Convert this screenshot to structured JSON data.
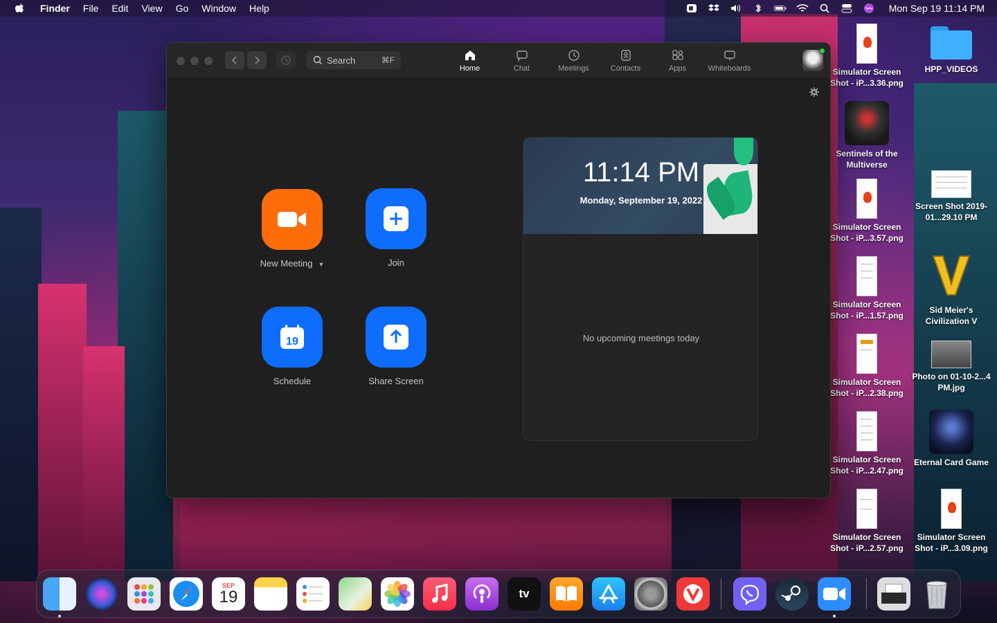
{
  "menubar": {
    "app_name": "Finder",
    "items": [
      "File",
      "Edit",
      "View",
      "Go",
      "Window",
      "Help"
    ],
    "clock": "Mon Sep 19  11:14 PM"
  },
  "desktop": {
    "items": [
      {
        "label": "Simulator Screen Shot - iP...3.36.png"
      },
      {
        "label": "HPP_VIDEOS"
      },
      {
        "label": "Sentinels of the Multiverse"
      },
      {
        "label": "Screen Shot 2019-01...29.10 PM"
      },
      {
        "label": "Simulator Screen Shot - iP...3.57.png"
      },
      {
        "label": "Sid Meier's Civilization V"
      },
      {
        "label": "Simulator Screen Shot - iP...1.57.png"
      },
      {
        "label": "Photo on 01-10-2...4 PM.jpg"
      },
      {
        "label": "Simulator Screen Shot - iP...2.38.png"
      },
      {
        "label": "Eternal Card Game"
      },
      {
        "label": "Simulator Screen Shot - iP...2.47.png"
      },
      {
        "label": "Simulator Screen Shot - iP...3.09.png"
      },
      {
        "label": "Simulator Screen Shot - iP...2.57.png"
      }
    ]
  },
  "zoom": {
    "search": {
      "placeholder": "Search",
      "shortcut": "⌘F"
    },
    "tabs": [
      {
        "label": "Home",
        "icon": "home-icon"
      },
      {
        "label": "Chat",
        "icon": "chat-icon"
      },
      {
        "label": "Meetings",
        "icon": "clock-icon"
      },
      {
        "label": "Contacts",
        "icon": "contacts-icon"
      },
      {
        "label": "Apps",
        "icon": "apps-icon"
      },
      {
        "label": "Whiteboards",
        "icon": "whiteboard-icon"
      }
    ],
    "actions": {
      "new_meeting": "New Meeting",
      "join": "Join",
      "schedule": "Schedule",
      "schedule_day": "19",
      "share_screen": "Share Screen"
    },
    "card": {
      "time": "11:14 PM",
      "date": "Monday, September 19, 2022",
      "empty": "No upcoming meetings today"
    }
  },
  "dock": {
    "calendar_month": "SEP",
    "calendar_day": "19",
    "tv_label": "tv"
  },
  "colors": {
    "orange": "#ff6c0a",
    "blue": "#0e6dfd",
    "window_bg": "#1f1f1f"
  }
}
